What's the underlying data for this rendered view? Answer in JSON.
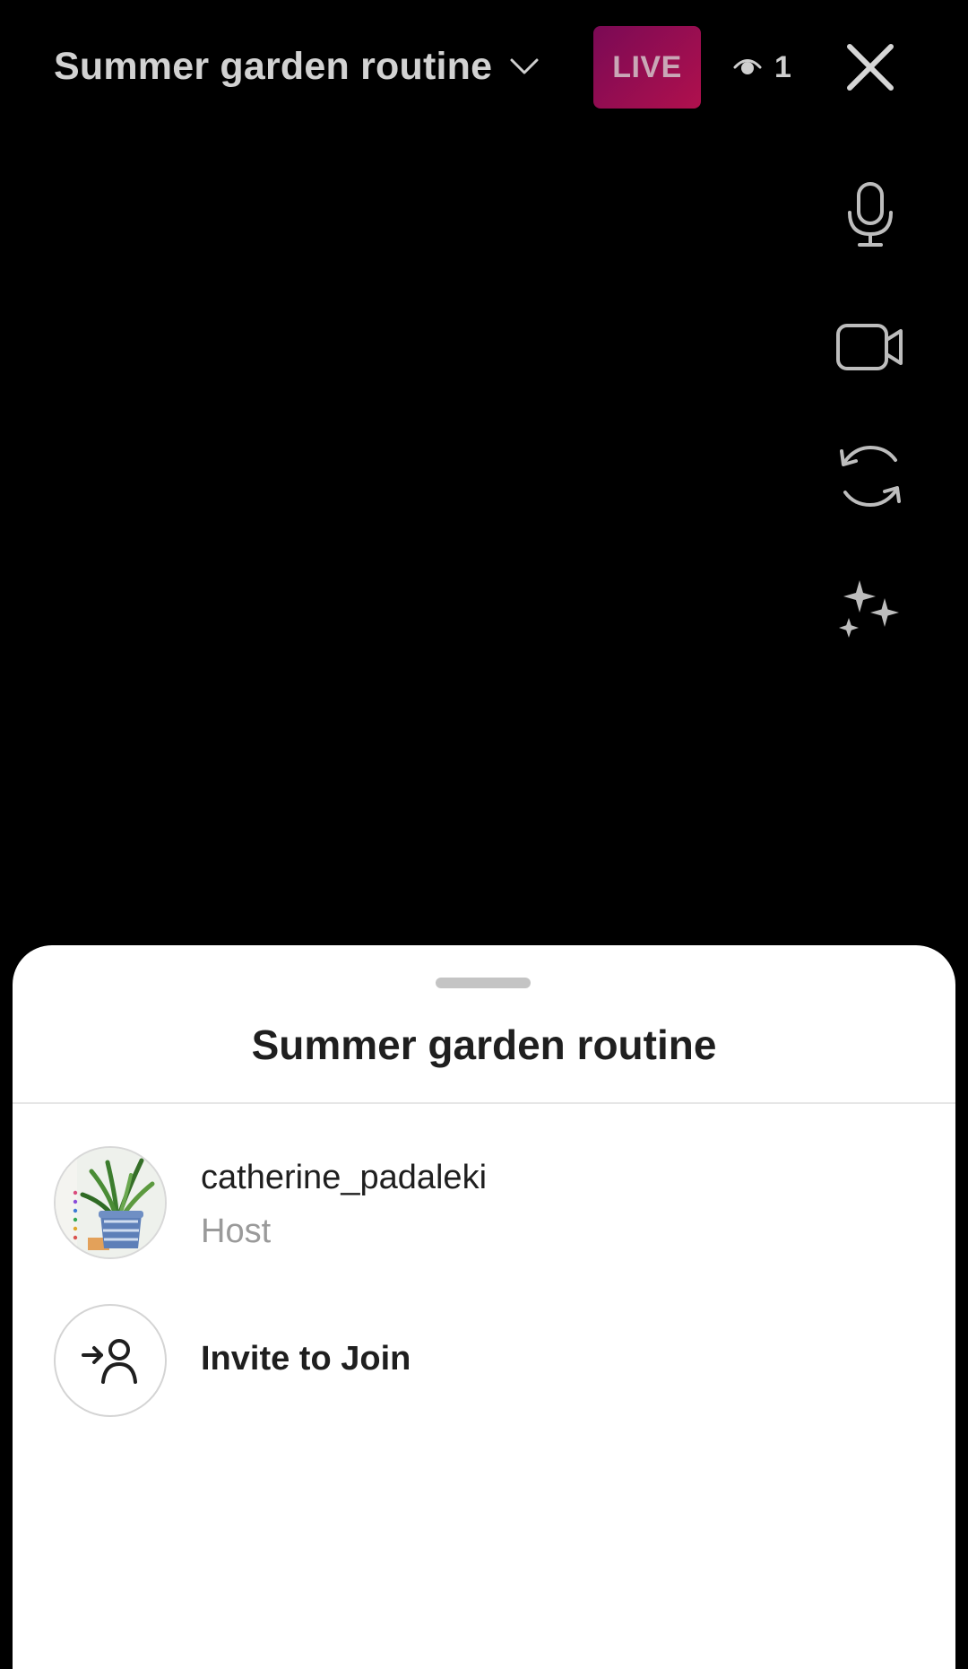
{
  "stream": {
    "title": "Summer garden routine",
    "live_label": "LIVE",
    "viewer_count": "1"
  },
  "icons": {
    "dropdown": "chevron-down-icon",
    "viewers": "eye-icon",
    "close": "close-icon",
    "microphone": "microphone-icon",
    "camera": "video-camera-icon",
    "flip": "flip-camera-icon",
    "effects": "sparkles-icon",
    "invite": "add-person-icon"
  },
  "colors": {
    "live_badge_start": "#7a0a55",
    "live_badge_end": "#b0104d",
    "sheet_background": "#ffffff",
    "screen_background": "#000000"
  },
  "sheet": {
    "title": "Summer garden routine",
    "participants": [
      {
        "username": "catherine_padaleki",
        "role": "Host"
      }
    ],
    "invite_label": "Invite to Join"
  }
}
